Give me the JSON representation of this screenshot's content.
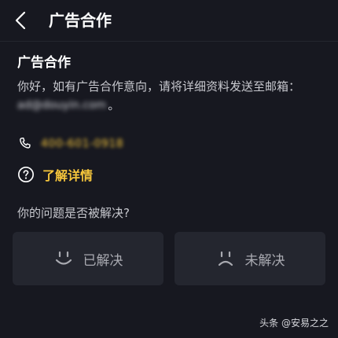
{
  "header": {
    "title": "广告合作"
  },
  "content": {
    "section_title": "广告合作",
    "description": "你好，如有广告合作意向，请将详细资料发送至邮箱：",
    "email": "ad@douyin.com",
    "email_suffix": "。",
    "phone": "400-601-0918",
    "details_link": "了解详情"
  },
  "feedback": {
    "question": "你的问题是否被解决?",
    "solved_label": "已解决",
    "unsolved_label": "未解决"
  },
  "watermark": "头条 @安易之之",
  "colors": {
    "background": "#171820",
    "accent": "#f6c63c",
    "button_bg": "#24262f"
  }
}
